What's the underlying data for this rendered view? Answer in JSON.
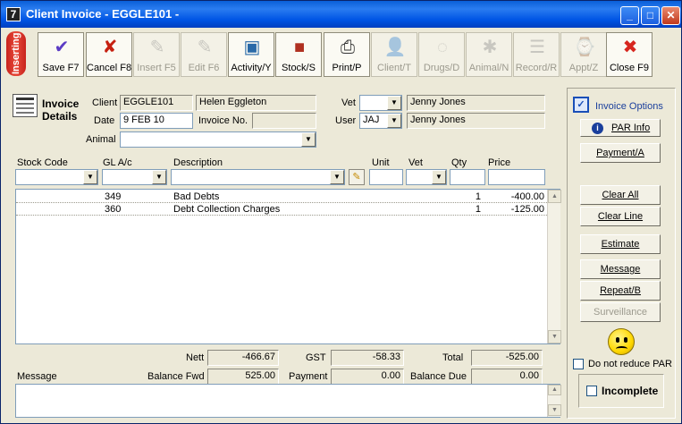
{
  "window": {
    "title": "Client Invoice - EGGLE101 -",
    "app_icon": "7"
  },
  "status_tab": "Inserting",
  "toolbar": [
    {
      "label": "Save F7",
      "icon": "✔",
      "enabled": true
    },
    {
      "label": "Cancel F8",
      "icon": "✘",
      "enabled": true
    },
    {
      "label": "Insert F5",
      "icon": "✎",
      "enabled": false
    },
    {
      "label": "Edit F6",
      "icon": "✎",
      "enabled": false
    },
    {
      "label": "Activity/Y",
      "icon": "▣",
      "enabled": true
    },
    {
      "label": "Stock/S",
      "icon": "■",
      "enabled": true
    },
    {
      "label": "Print/P",
      "icon": "⎙",
      "enabled": true
    },
    {
      "label": "Client/T",
      "icon": "👤",
      "enabled": false
    },
    {
      "label": "Drugs/D",
      "icon": "◌",
      "enabled": false
    },
    {
      "label": "Animal/N",
      "icon": "✱",
      "enabled": false
    },
    {
      "label": "Record/R",
      "icon": "☰",
      "enabled": false
    },
    {
      "label": "Appt/Z",
      "icon": "⌚",
      "enabled": false
    },
    {
      "label": "Close F9",
      "icon": "✖",
      "enabled": true
    }
  ],
  "details": {
    "heading_line1": "Invoice",
    "heading_line2": "Details",
    "client_label": "Client",
    "client_code": "EGGLE101",
    "client_name": "Helen Eggleton",
    "date_label": "Date",
    "date": "9 FEB 10",
    "invoice_no_label": "Invoice No.",
    "invoice_no": "",
    "animal_label": "Animal",
    "animal": "",
    "vet_label": "Vet",
    "vet_code": "",
    "vet_name": "Jenny Jones",
    "user_label": "User",
    "user_code": "JAJ",
    "user_name": "Jenny Jones"
  },
  "line_headers": {
    "stock_code": "Stock Code",
    "gl": "GL A/c",
    "description": "Description",
    "unit": "Unit",
    "vet": "Vet",
    "qty": "Qty",
    "price": "Price"
  },
  "lines": [
    {
      "gl": "349",
      "description": "Bad Debts",
      "qty": "1",
      "price": "-400.00"
    },
    {
      "gl": "360",
      "description": "Debt Collection Charges",
      "qty": "1",
      "price": "-125.00"
    }
  ],
  "totals": {
    "nett_label": "Nett",
    "nett": "-466.67",
    "gst_label": "GST",
    "gst": "-58.33",
    "total_label": "Total",
    "total": "-525.00",
    "balance_fwd_label": "Balance Fwd",
    "balance_fwd": "525.00",
    "payment_label": "Payment",
    "payment": "0.00",
    "balance_due_label": "Balance Due",
    "balance_due": "0.00"
  },
  "message_label": "Message",
  "side": {
    "invoice_options": "Invoice Options",
    "par_info": "PAR Info",
    "payment": "Payment/A",
    "clear_all": "Clear All",
    "clear_line": "Clear Line",
    "estimate": "Estimate",
    "message": "Message",
    "repeat": "Repeat/B",
    "surveillance": "Surveillance",
    "do_not_reduce": "Do not reduce PAR",
    "incomplete": "Incomplete"
  }
}
